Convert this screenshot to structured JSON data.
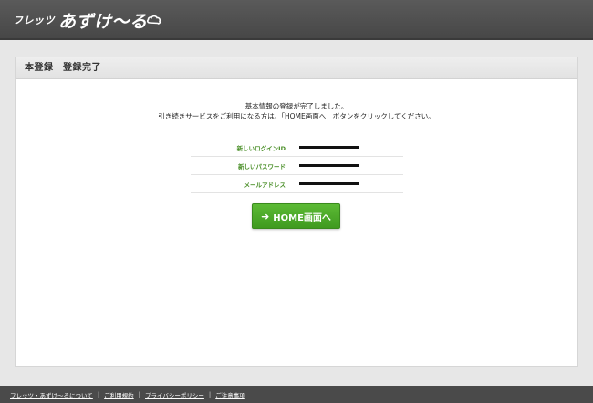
{
  "header": {
    "logo_sub": "フレッツ",
    "logo_main": "あずけ〜る"
  },
  "panel": {
    "title": "本登録　登録完了",
    "message_line1": "基本情報の登録が完了しました。",
    "message_line2": "引き続きサービスをご利用になる方は、「HOME画面へ」ボタンをクリックしてください。",
    "rows": [
      {
        "label": "新しいログインID"
      },
      {
        "label": "新しいパスワード"
      },
      {
        "label": "メールアドレス"
      }
    ],
    "home_button": "HOME画面へ"
  },
  "footer": {
    "links": [
      "フレッツ・あずけ〜るについて",
      "ご利用規約",
      "プライバシーポリシー",
      "ご注意事項"
    ]
  },
  "colors": {
    "accent_green": "#4a9e27",
    "label_green": "#4a8f28",
    "header_bg": "#4f4f4f"
  }
}
